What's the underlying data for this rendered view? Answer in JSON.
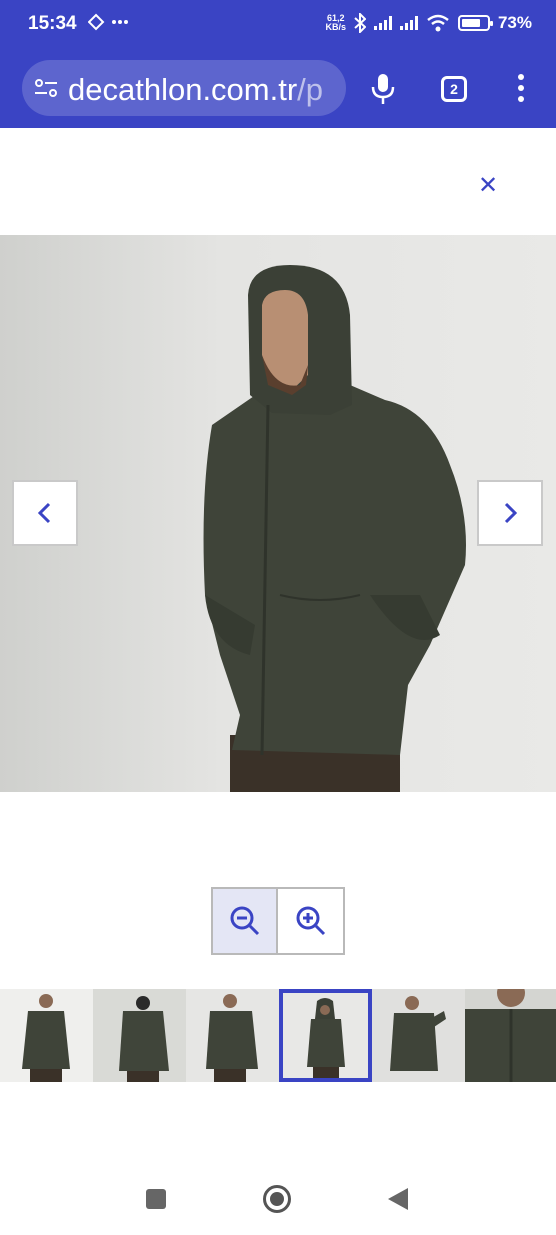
{
  "status_bar": {
    "time": "15:34",
    "speed_value": "61,2",
    "speed_unit": "KB/s",
    "battery_percent": "73%",
    "battery_level": 0.73
  },
  "browser": {
    "url_host": "decathlon.com.tr",
    "url_path": "/p",
    "tab_count": "2"
  },
  "viewer": {
    "close_icon": "close-icon",
    "prev_icon": "chevron-left-icon",
    "next_icon": "chevron-right-icon",
    "zoom_out_icon": "zoom-out-icon",
    "zoom_in_icon": "zoom-in-icon",
    "thumbnail_count": 6,
    "selected_thumbnail": 4
  },
  "colors": {
    "accent": "#3a44c4",
    "jacket": "#3f4439",
    "background": "#ffffff"
  }
}
